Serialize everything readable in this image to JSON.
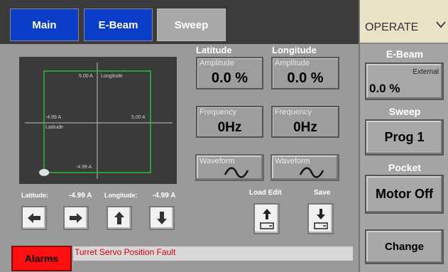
{
  "tabs": [
    {
      "label": "Main",
      "active": false
    },
    {
      "label": "E-Beam",
      "active": false
    },
    {
      "label": "Sweep",
      "active": true
    }
  ],
  "plot": {
    "x_max_label": "5.00 A",
    "x_axis_name": "Longitude",
    "y_min_label": "-4.99 A",
    "y_axis_name": "Latitude",
    "x_right_label": "5.00 A",
    "y_bottom_label": "-4.99 A",
    "position": {
      "latitude": -4.99,
      "longitude": -4.99
    }
  },
  "readouts": {
    "latitude_label": "Latitude:",
    "latitude_value": "-4.99 A",
    "longitude_label": "Longitude:",
    "longitude_value": "-4.99 A"
  },
  "jog_buttons": [
    "arrow-left-icon",
    "arrow-right-icon",
    "arrow-up-icon",
    "arrow-down-icon"
  ],
  "latitude": {
    "heading": "Latitude",
    "amplitude_caption": "Amplitude",
    "amplitude_value": "0.0 %",
    "frequency_caption": "Frequency",
    "frequency_value": "0Hz",
    "waveform_caption": "Waveform",
    "waveform_icon": "sine-wave-icon"
  },
  "longitude": {
    "heading": "Longitude",
    "amplitude_caption": "Amplitude",
    "amplitude_value": "0.0 %",
    "frequency_caption": "Frequency",
    "frequency_value": "0Hz",
    "waveform_caption": "Waveform",
    "waveform_icon": "sine-wave-icon"
  },
  "file_controls": {
    "load_edit_label": "Load Edit",
    "save_label": "Save"
  },
  "alarm": {
    "button_label": "Alarms",
    "message": "Turret Servo Position Fault"
  },
  "right_panel": {
    "mode_label": "OPERATE",
    "ebeam_heading": "E-Beam",
    "ebeam_source": "External",
    "ebeam_value": "0.0 %",
    "sweep_heading": "Sweep",
    "sweep_value": "Prog 1",
    "pocket_heading": "Pocket",
    "pocket_value": "Motor Off",
    "change_label": "Change"
  },
  "colors": {
    "tab_active_blue": "#0a3ec8",
    "plot_trace": "#22c03a",
    "alarm_red": "#ff1010",
    "alarm_text": "#d40000"
  }
}
